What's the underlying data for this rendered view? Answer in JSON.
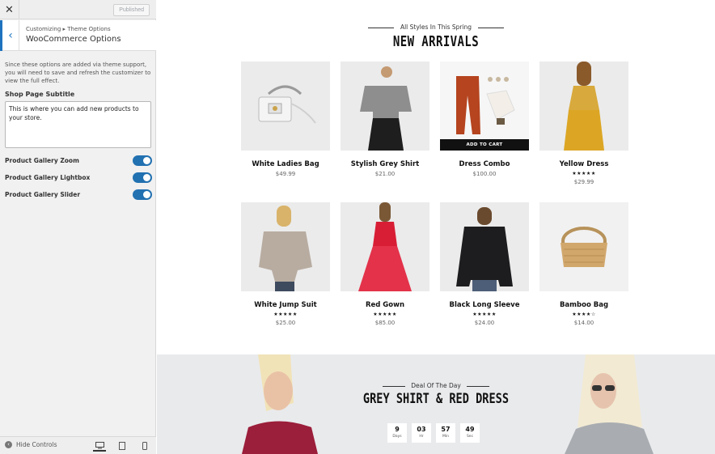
{
  "customizer": {
    "close_icon": "close-icon",
    "publish_label": "Published",
    "breadcrumb": "Customizing ▸ Theme Options",
    "section_title": "WooCommerce Options",
    "notice": "Since these options are added via theme support, you will need to save and refresh the customizer to view the full effect.",
    "shop_subtitle_label": "Shop Page Subtitle",
    "shop_subtitle_value": "This is where you can add new products to your store.",
    "toggles": [
      {
        "label": "Product Gallery Zoom",
        "on": true
      },
      {
        "label": "Product Gallery Lightbox",
        "on": true
      },
      {
        "label": "Product Gallery Slider",
        "on": true
      }
    ],
    "hide_controls_label": "Hide Controls",
    "accent_color": "#2271b1"
  },
  "preview": {
    "pretitle": "All Styles In This Spring",
    "title": "NEW ARRIVALS",
    "add_to_cart": "ADD TO CART",
    "products": [
      {
        "name": "White Ladies Bag",
        "price": "$49.99",
        "stars": ""
      },
      {
        "name": "Stylish Grey Shirt",
        "price": "$21.00",
        "stars": ""
      },
      {
        "name": "Dress Combo",
        "price": "$100.00",
        "stars": ""
      },
      {
        "name": "Yellow Dress",
        "price": "$29.99",
        "stars": "★★★★★"
      },
      {
        "name": "White Jump Suit",
        "price": "$25.00",
        "stars": "★★★★★"
      },
      {
        "name": "Red Gown",
        "price": "$85.00",
        "stars": "★★★★★"
      },
      {
        "name": "Black Long Sleeve",
        "price": "$24.00",
        "stars": "★★★★★"
      },
      {
        "name": "Bamboo Bag",
        "price": "$14.00",
        "stars": "★★★★☆"
      }
    ],
    "deal": {
      "pretitle": "Deal Of The Day",
      "title": "GREY SHIRT & RED DRESS",
      "countdown": [
        {
          "value": "9",
          "unit": "Days"
        },
        {
          "value": "03",
          "unit": "Hr"
        },
        {
          "value": "57",
          "unit": "Min"
        },
        {
          "value": "49",
          "unit": "Sec"
        }
      ]
    }
  }
}
